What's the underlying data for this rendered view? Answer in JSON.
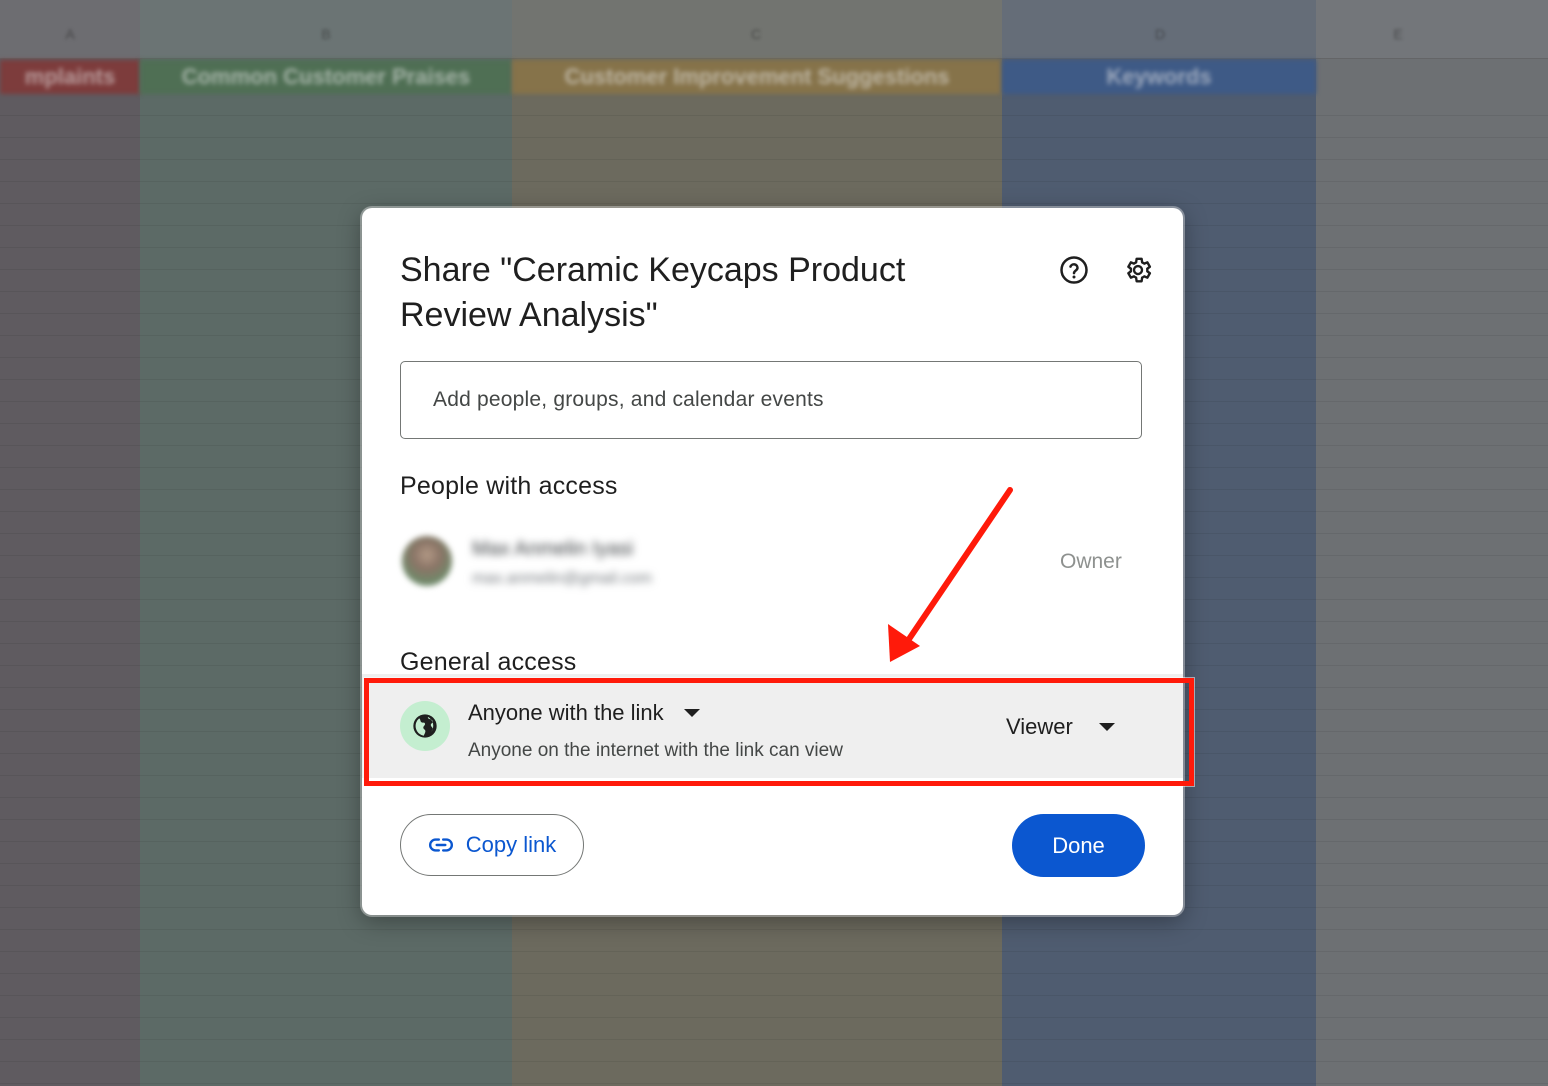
{
  "background": {
    "column_letters": [
      "A",
      "B",
      "C",
      "D",
      "E"
    ],
    "headers": [
      "mplaints",
      "Common Customer Praises",
      "Customer Improvement Suggestions",
      "Keywords"
    ]
  },
  "dialog": {
    "title": "Share \"Ceramic Keycaps Product Review Analysis\"",
    "help_icon": "help-circle-icon",
    "settings_icon": "gear-icon",
    "add_input": {
      "value": "",
      "placeholder": "Add people, groups, and calendar events"
    },
    "people_section_title": "People with access",
    "owner": {
      "name": "Max Anmelin Iyasi",
      "email": "max.anmelin@gmail.com",
      "role": "Owner"
    },
    "general_section_title": "General access",
    "general_access": {
      "icon": "globe-icon",
      "type": "Anyone with the link",
      "description": "Anyone on the internet with the link can view",
      "role": "Viewer"
    },
    "copy_link_label": "Copy link",
    "done_label": "Done"
  },
  "annotation": {
    "highlight_color": "#ff1a0a"
  },
  "colors": {
    "primary": "#0b57d0",
    "globe_bg": "#c4eed0"
  }
}
